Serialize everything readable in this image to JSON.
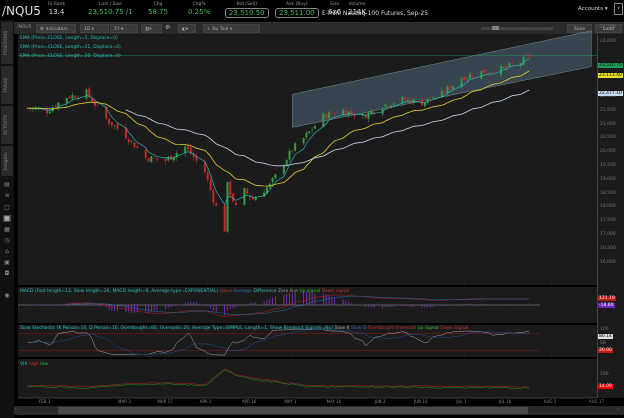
{
  "header": {
    "symbol": "/NQU5",
    "stats": [
      {
        "label": "IV Rank",
        "value": "13.4"
      },
      {
        "label": "Last / Size",
        "value": "23,510.75 /1"
      },
      {
        "label": "Chg",
        "value": "58.75"
      },
      {
        "label": "Chg%",
        "value": "0.25%"
      },
      {
        "label": "Bid (Sell)",
        "value": "23,510.50"
      },
      {
        "label": "Ask (Buy)",
        "value": "23,511.00"
      },
      {
        "label": "Size",
        "value": "6x6"
      },
      {
        "label": "Volume",
        "value": "214K"
      }
    ],
    "description": "E-mini Nasdaq-100 Futures, Sep-25",
    "accounts": "Accounts",
    "collapse_icon": "chevron-left"
  },
  "toolbar": {
    "symbol": "/NQU5",
    "indicators": "Indicators",
    "period": "1D",
    "range": "1Y",
    "tool": "No Tool",
    "save": "Save",
    "load": "Load"
  },
  "sidebar": {
    "tabs": [
      "POSITIONS",
      "TRADE",
      "ACTIVITY",
      "Insights"
    ]
  },
  "studies": {
    "ema": [
      "EMA (Price=CLOSE, Length=5, Displace=0)",
      "EMA (Price=CLOSE, Length=21, Displace=0)",
      "EMA (Price=CLOSE, Length=50, Displace=0)"
    ],
    "macd": {
      "label": "MACD (Fast length=12, Slow length=26, MACD length=9, Average type=EXPONENTIAL)",
      "legend": [
        "Value",
        "Average",
        "Difference",
        "Zero line",
        "Up signal",
        "Down signal"
      ],
      "value": "121.19",
      "diff": "-18.60"
    },
    "stoch": {
      "label": "Slow Stochastic (K Period=10, D Period=10, Overbought=80, Oversold=20, Average Type=SIMPLE, Length=1, Show Breakout Signals=No)",
      "legend": [
        "Slow K",
        "Slow D",
        "Overbought",
        "Oversold",
        "Up Signal",
        "Down Signal"
      ],
      "ticks": [
        "100",
        "50"
      ],
      "k": "80.14",
      "oversold": "20.00"
    },
    "vix": {
      "label": "VIX",
      "legend": [
        "high",
        "low"
      ],
      "tick": "100",
      "value": "14.09"
    }
  },
  "colors": {
    "up": "#2f9e44",
    "down": "#c62828",
    "ema5": "#2ec4c4",
    "ema21": "#e0d030",
    "ema50": "#c8d8f0",
    "last": "#1fa05a"
  },
  "chart_data": {
    "type": "candlestick",
    "title": "/NQU5 1D",
    "ylim": [
      16000,
      24750
    ],
    "yticks": [
      "24,500",
      "24,000",
      "22,000",
      "21,500",
      "21,000",
      "20,500",
      "20,000",
      "19,500",
      "19,000",
      "18,500",
      "18,000",
      "17,500",
      "17,000",
      "16,500",
      "16,000"
    ],
    "price_tags": {
      "last": "23,510.75",
      "ema21": "23,113.40",
      "ema50": "22,477.10"
    },
    "xticks": [
      {
        "label": "FEB 3",
        "day": 7
      },
      {
        "label": "MAR 3",
        "day": 35
      },
      {
        "label": "MAR 17",
        "day": 49
      },
      {
        "label": "APR 1",
        "day": 64
      },
      {
        "label": "APR 16",
        "day": 79
      },
      {
        "label": "MAY 1",
        "day": 94
      },
      {
        "label": "MAY 16",
        "day": 109
      },
      {
        "label": "JUN 2",
        "day": 126
      },
      {
        "label": "JUN 16",
        "day": 140
      },
      {
        "label": "JUL 1",
        "day": 155
      },
      {
        "label": "JUL 16",
        "day": 170
      },
      {
        "label": "AUG 1",
        "day": 186
      },
      {
        "label": "AUG 17",
        "day": 202
      }
    ],
    "close_keypoints": [
      [
        0,
        21600
      ],
      [
        7,
        21500
      ],
      [
        14,
        22000
      ],
      [
        21,
        22150
      ],
      [
        28,
        21200
      ],
      [
        35,
        20600
      ],
      [
        42,
        19800
      ],
      [
        49,
        19700
      ],
      [
        56,
        20200
      ],
      [
        63,
        19300
      ],
      [
        66,
        18300
      ],
      [
        70,
        17200
      ],
      [
        71,
        18800
      ],
      [
        74,
        18000
      ],
      [
        77,
        18600
      ],
      [
        80,
        18300
      ],
      [
        86,
        18800
      ],
      [
        94,
        20100
      ],
      [
        98,
        20500
      ],
      [
        105,
        21300
      ],
      [
        112,
        21500
      ],
      [
        119,
        21300
      ],
      [
        126,
        21700
      ],
      [
        133,
        21900
      ],
      [
        140,
        21800
      ],
      [
        147,
        22100
      ],
      [
        154,
        22700
      ],
      [
        161,
        22900
      ],
      [
        168,
        23000
      ],
      [
        175,
        23250
      ],
      [
        178,
        23510
      ]
    ],
    "channel": {
      "start_day": 94,
      "end_day": 200,
      "lower": [
        20900,
        23100
      ],
      "upper": [
        22100,
        24400
      ]
    },
    "vix_keypoints": [
      [
        0,
        18
      ],
      [
        21,
        16
      ],
      [
        35,
        22
      ],
      [
        49,
        24
      ],
      [
        63,
        20
      ],
      [
        70,
        52
      ],
      [
        74,
        40
      ],
      [
        80,
        33
      ],
      [
        90,
        25
      ],
      [
        100,
        18
      ],
      [
        140,
        17
      ],
      [
        170,
        16
      ],
      [
        178,
        15
      ]
    ]
  }
}
